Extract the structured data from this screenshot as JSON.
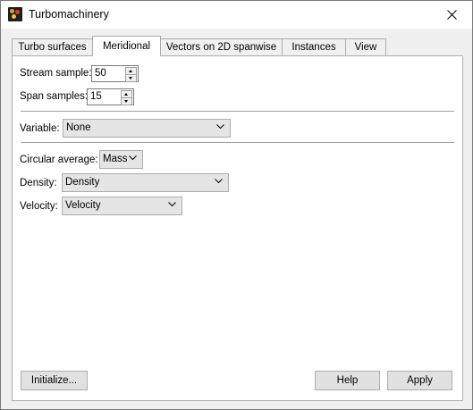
{
  "window": {
    "title": "Turbomachinery"
  },
  "tabs": [
    {
      "label": "Turbo surfaces"
    },
    {
      "label": "Meridional",
      "active": true
    },
    {
      "label": "Vectors on 2D spanwise"
    },
    {
      "label": "Instances"
    },
    {
      "label": "View"
    }
  ],
  "meridional": {
    "stream_sample_label": "Stream sample:",
    "stream_sample_value": "50",
    "span_samples_label": "Span samples:",
    "span_samples_value": "15",
    "variable_label": "Variable:",
    "variable_value": "None",
    "circular_average_label": "Circular average:",
    "circular_average_value": "Mass",
    "density_label": "Density:",
    "density_value": "Density",
    "velocity_label": "Velocity:",
    "velocity_value": "Velocity"
  },
  "buttons": {
    "initialize": "Initialize...",
    "help": "Help",
    "apply": "Apply"
  },
  "icons": {
    "app": "turbomachinery-app-icon",
    "close": "close-icon",
    "dropdown": "chevron-down-icon",
    "spin_up": "spin-up-icon",
    "spin_down": "spin-down-icon"
  }
}
